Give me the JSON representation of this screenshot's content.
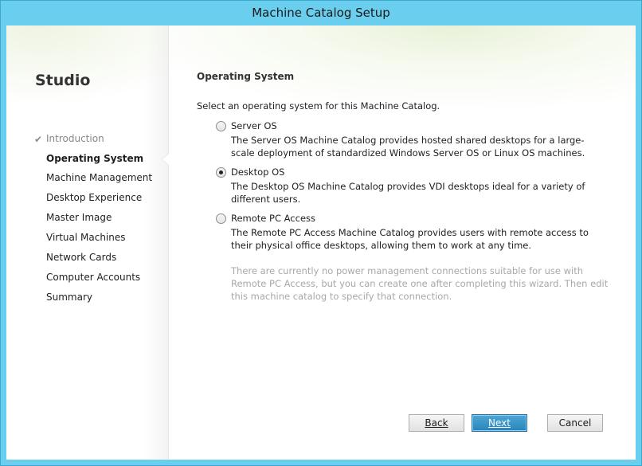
{
  "window": {
    "title": "Machine Catalog Setup"
  },
  "sidebar": {
    "brand": "Studio",
    "steps": [
      {
        "label": "Introduction",
        "state": "done"
      },
      {
        "label": "Operating System",
        "state": "active"
      },
      {
        "label": "Machine Management",
        "state": "pending"
      },
      {
        "label": "Desktop Experience",
        "state": "pending"
      },
      {
        "label": "Master Image",
        "state": "pending"
      },
      {
        "label": "Virtual Machines",
        "state": "pending"
      },
      {
        "label": "Network Cards",
        "state": "pending"
      },
      {
        "label": "Computer Accounts",
        "state": "pending"
      },
      {
        "label": "Summary",
        "state": "pending"
      }
    ],
    "check_icon": "checkmark-icon"
  },
  "main": {
    "title": "Operating System",
    "instruction": "Select an operating system for this Machine Catalog.",
    "options": [
      {
        "label": "Server OS",
        "description": "The Server OS Machine Catalog provides hosted shared desktops for a large-scale deployment of standardized Windows Server OS or Linux OS machines.",
        "selected": false
      },
      {
        "label": "Desktop OS",
        "description": "The Desktop OS Machine Catalog provides VDI desktops ideal for a variety of different users.",
        "selected": true
      },
      {
        "label": "Remote PC Access",
        "description": "The Remote PC Access Machine Catalog provides users with remote access to their physical office desktops, allowing them to work at any time.",
        "note": "There are currently no power management connections suitable for use with Remote PC Access, but you can create one after completing this wizard. Then edit this machine catalog to specify that connection.",
        "selected": false
      }
    ]
  },
  "buttons": {
    "back": "Back",
    "next": "Next",
    "cancel": "Cancel"
  },
  "colors": {
    "frame": "#6acfee",
    "primary_button": "#2a84b9"
  }
}
